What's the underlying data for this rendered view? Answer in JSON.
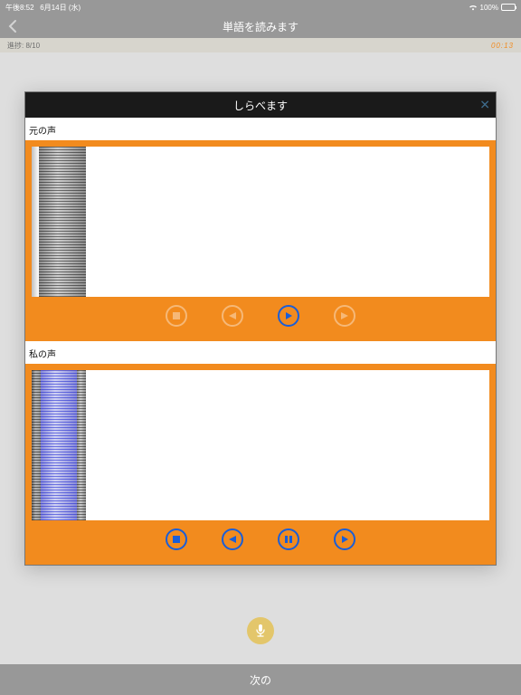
{
  "status": {
    "time": "午後8:52",
    "date": "6月14日 (水)",
    "wifi": true,
    "battery_pct": "100%"
  },
  "nav": {
    "title": "単語を読みます"
  },
  "progress": {
    "label": "進捗: 8/10",
    "timer": "00:13"
  },
  "modal": {
    "title": "しらべます",
    "close_glyph": "✕",
    "section_original": "元の声",
    "section_mine": "私の声"
  },
  "controls": {
    "stop": "stop",
    "rewind": "rewind",
    "play": "play",
    "pause": "pause",
    "forward": "forward"
  },
  "mic": {
    "label": "record"
  },
  "bottom": {
    "next": "次の"
  }
}
